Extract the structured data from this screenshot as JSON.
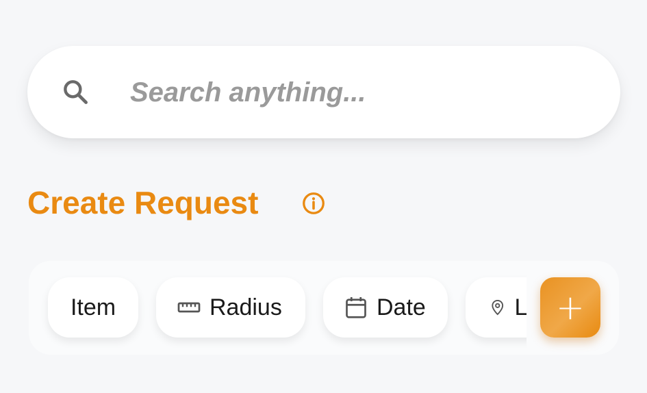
{
  "search": {
    "placeholder": "Search anything..."
  },
  "section": {
    "title": "Create Request"
  },
  "filters": {
    "chips": [
      {
        "label": "Item",
        "icon": "none"
      },
      {
        "label": "Radius",
        "icon": "ruler-icon"
      },
      {
        "label": "Date",
        "icon": "calendar-icon"
      },
      {
        "label": "Location",
        "icon": "location-pin-icon"
      }
    ]
  },
  "fab": {
    "symbol": "+"
  },
  "colors": {
    "accent": "#e98a12",
    "background": "#f6f7f9",
    "placeholder": "#999999"
  }
}
